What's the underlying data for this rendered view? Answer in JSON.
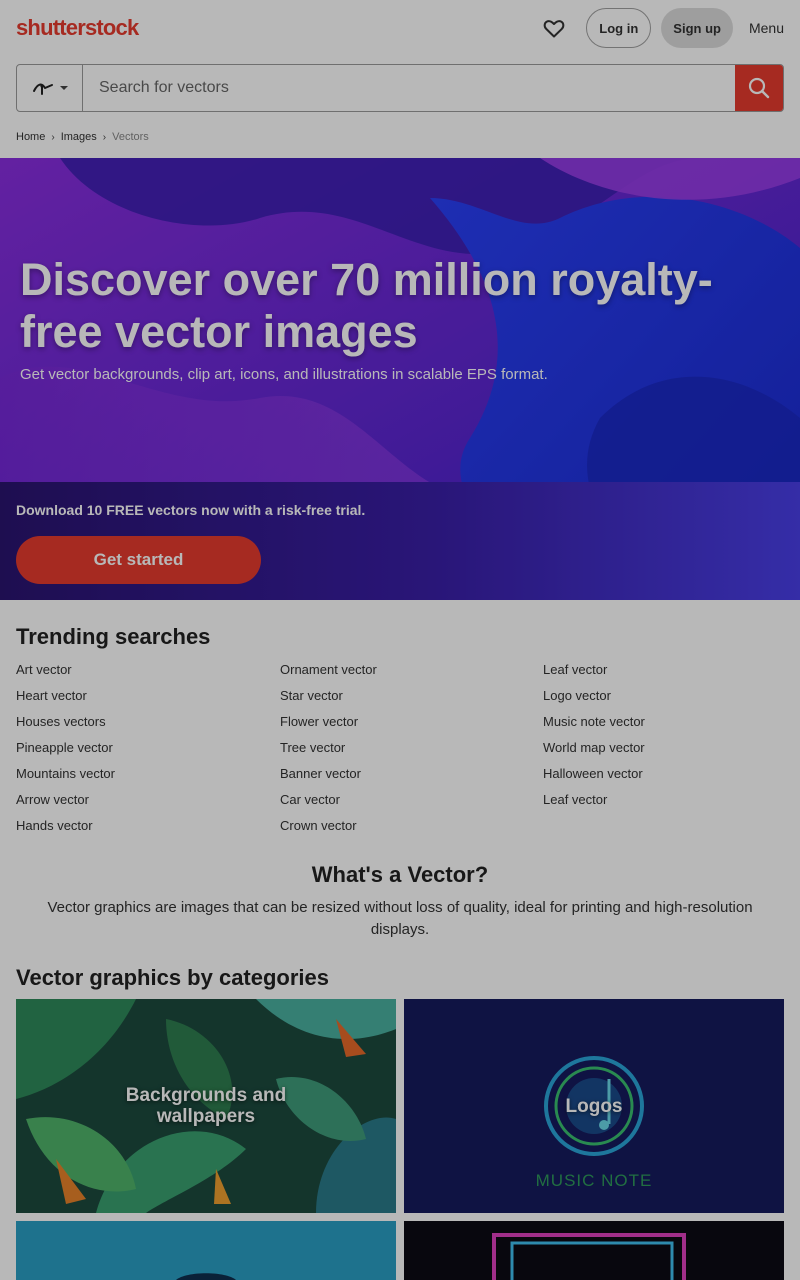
{
  "header": {
    "logo_text": "shutterstock",
    "login_label": "Log in",
    "signup_label": "Sign up",
    "menu_label": "Menu"
  },
  "search": {
    "placeholder": "Search for vectors"
  },
  "breadcrumb": {
    "items": [
      "Home",
      "Images"
    ],
    "current": "Vectors"
  },
  "hero": {
    "title": "Discover over 70 million royalty-free vector images",
    "subtitle": "Get vector backgrounds, clip art, icons, and illustrations in scalable EPS format.",
    "promo_text": "Download 10 FREE vectors now with a risk-free trial.",
    "cta_label": "Get started"
  },
  "trending": {
    "title": "Trending searches",
    "col1": [
      "Art vector",
      "Heart vector",
      "Houses vectors",
      "Pineapple vector",
      "Mountains vector",
      "Arrow vector",
      "Hands vector"
    ],
    "col2": [
      "Ornament vector",
      "Star vector",
      "Flower vector",
      "Tree vector",
      "Banner vector",
      "Car vector",
      "Crown vector"
    ],
    "col3": [
      "Leaf vector",
      "Logo vector",
      "Music note vector",
      "World map vector",
      "Halloween vector",
      "Leaf vector"
    ]
  },
  "whats_vector": {
    "title": "What's a Vector?",
    "description": "Vector graphics are images that can be resized without loss of quality, ideal for printing and high-resolution displays."
  },
  "categories": {
    "title": "Vector graphics by categories",
    "tiles": [
      {
        "label": "Backgrounds and wallpapers"
      },
      {
        "label": "Logos",
        "logo_caption": "MUSIC NOTE"
      }
    ]
  },
  "colors": {
    "brand": "#e63b2e",
    "hero_purple": "#4a1fb8",
    "hero_blue": "#2a3ef0"
  }
}
